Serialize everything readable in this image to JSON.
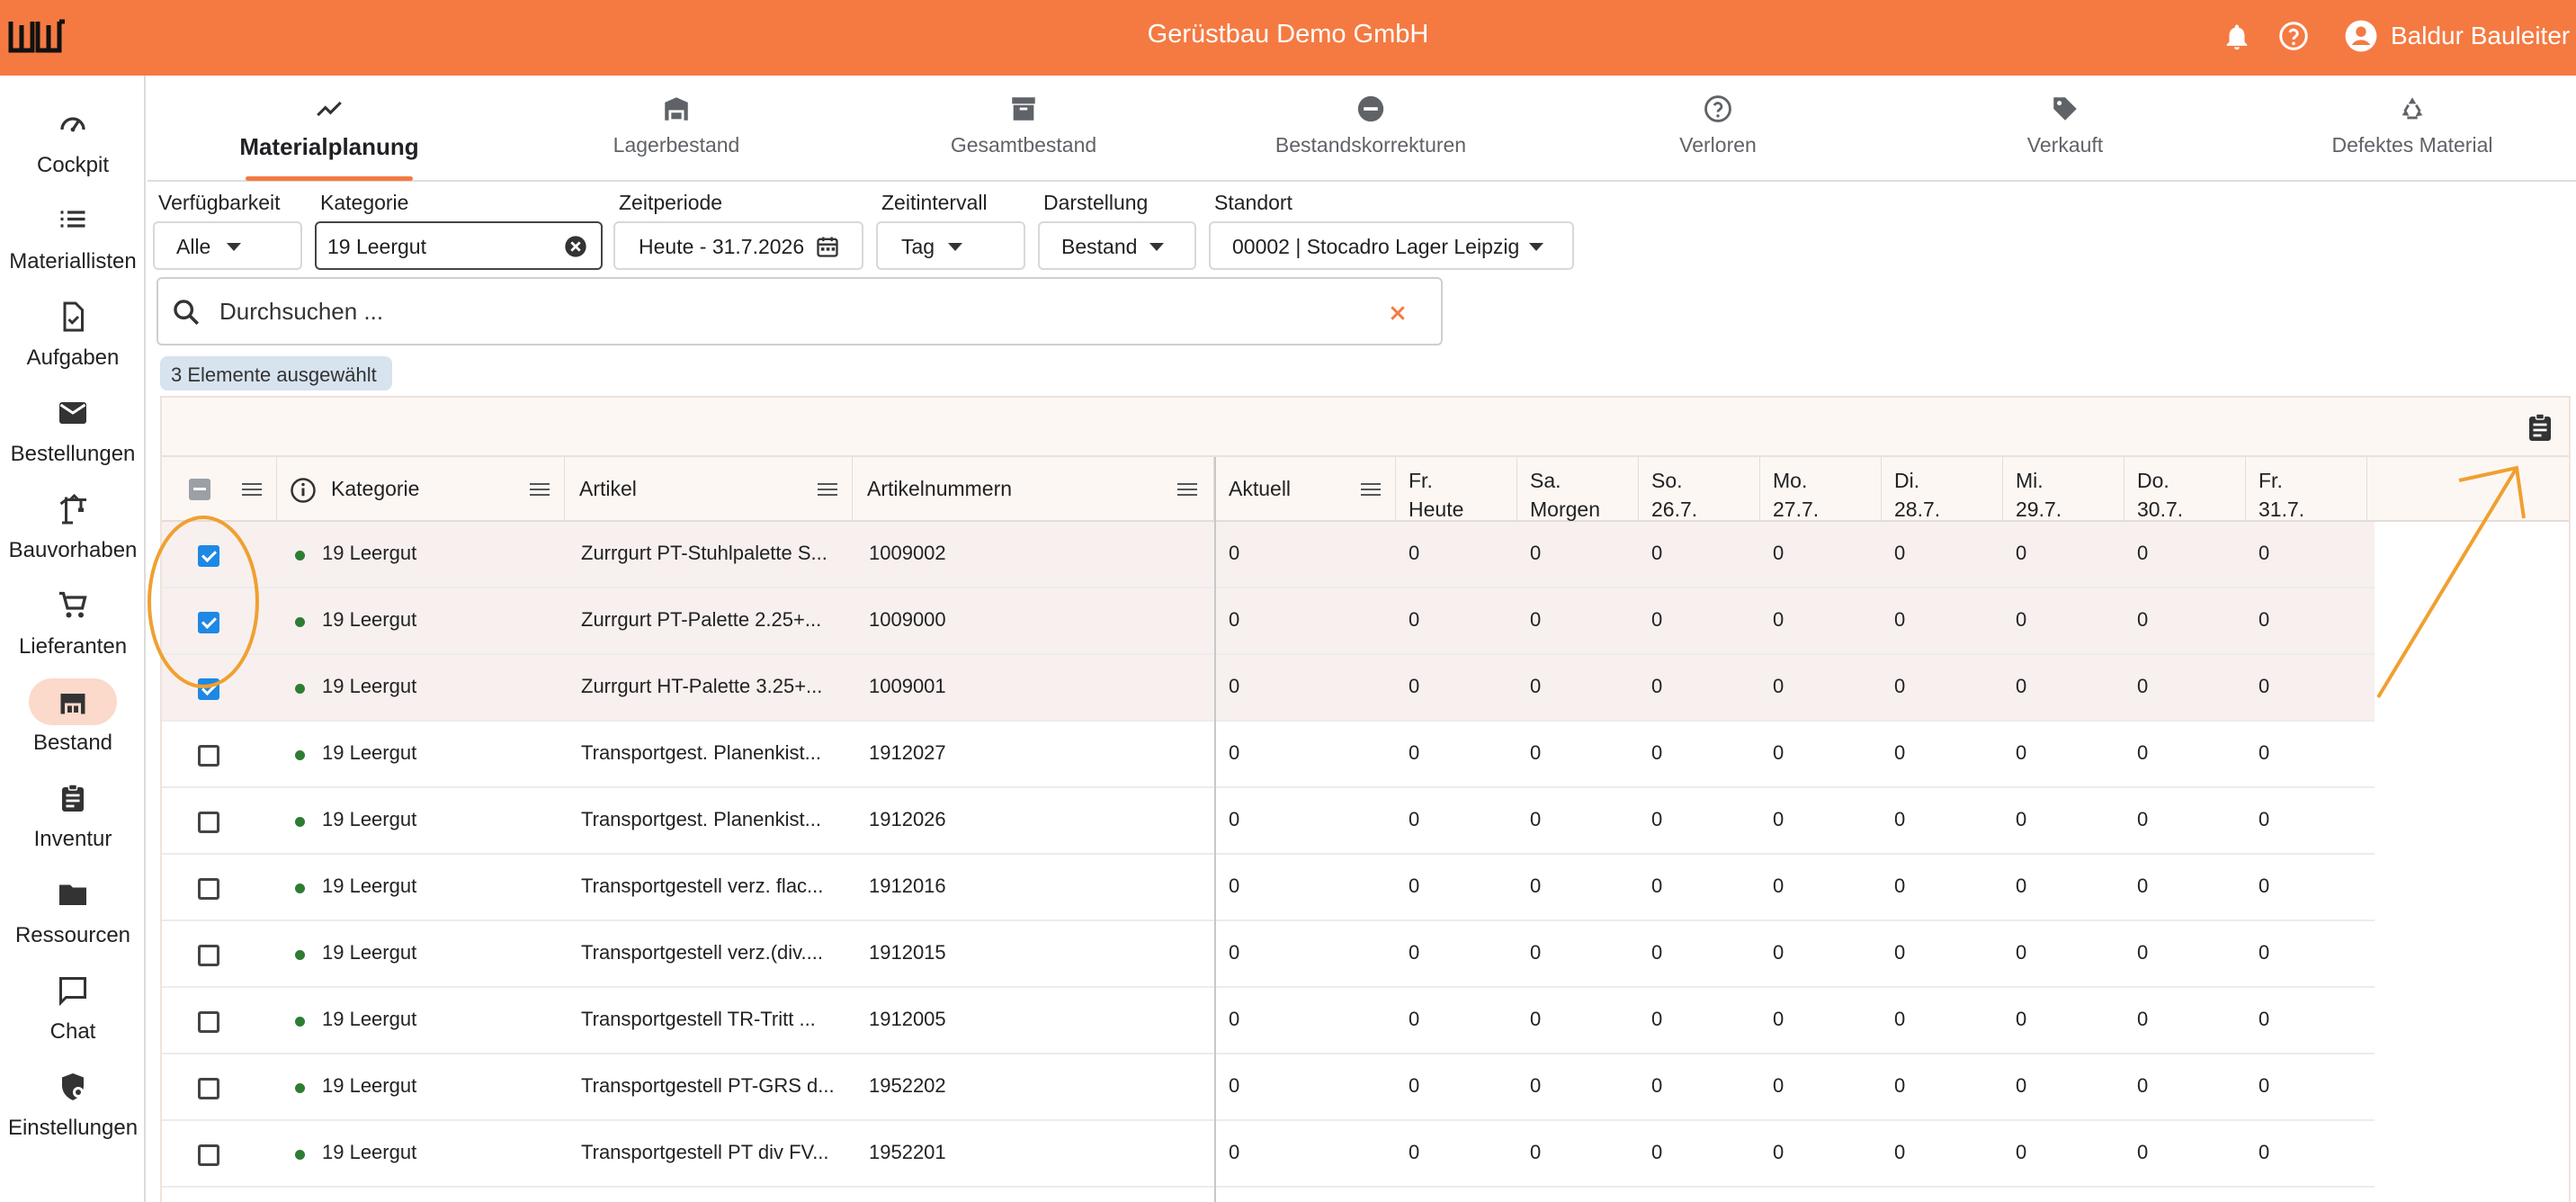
{
  "header": {
    "company": "Gerüstbau Demo GmbH",
    "user_name": "Baldur Bauleiter"
  },
  "sidebar": {
    "items": [
      {
        "label": "Cockpit",
        "icon": "speedometer-icon"
      },
      {
        "label": "Materiallisten",
        "icon": "list-icon"
      },
      {
        "label": "Aufgaben",
        "icon": "task-check-icon"
      },
      {
        "label": "Bestellungen",
        "icon": "mail-icon"
      },
      {
        "label": "Bauvorhaben",
        "icon": "crane-icon"
      },
      {
        "label": "Lieferanten",
        "icon": "cart-icon"
      },
      {
        "label": "Bestand",
        "icon": "warehouse-icon"
      },
      {
        "label": "Inventur",
        "icon": "clipboard-icon"
      },
      {
        "label": "Ressourcen",
        "icon": "folder-icon"
      },
      {
        "label": "Chat",
        "icon": "chat-icon"
      },
      {
        "label": "Einstellungen",
        "icon": "settings-shield-icon"
      }
    ]
  },
  "tabs": [
    {
      "label": "Materialplanung",
      "icon": "trend-icon"
    },
    {
      "label": "Lagerbestand",
      "icon": "warehouse-icon"
    },
    {
      "label": "Gesamtbestand",
      "icon": "archive-icon"
    },
    {
      "label": "Bestandskorrekturen",
      "icon": "minus-circle-icon"
    },
    {
      "label": "Verloren",
      "icon": "question-circle-icon"
    },
    {
      "label": "Verkauft",
      "icon": "tag-icon"
    },
    {
      "label": "Defektes Material",
      "icon": "recycle-icon"
    }
  ],
  "filters": {
    "verfuegbarkeit": {
      "label": "Verfügbarkeit",
      "value": "Alle"
    },
    "kategorie": {
      "label": "Kategorie",
      "value": "19 Leergut"
    },
    "zeitperiode": {
      "label": "Zeitperiode",
      "value": "Heute - 31.7.2026"
    },
    "zeitintervall": {
      "label": "Zeitintervall",
      "value": "Tag"
    },
    "darstellung": {
      "label": "Darstellung",
      "value": "Bestand"
    },
    "standort": {
      "label": "Standort",
      "value": "00002 | Stocadro Lager Leipzig"
    }
  },
  "search": {
    "placeholder": "Durchsuchen ..."
  },
  "selection_chip": "3 Elemente ausgewählt",
  "table": {
    "columns": {
      "kategorie": "Kategorie",
      "artikel": "Artikel",
      "artikelnummern": "Artikelnummern",
      "aktuell": "Aktuell"
    },
    "date_columns": [
      {
        "line1": "Fr.",
        "line2": "Heute"
      },
      {
        "line1": "Sa.",
        "line2": "Morgen"
      },
      {
        "line1": "So.",
        "line2": "26.7."
      },
      {
        "line1": "Mo.",
        "line2": "27.7."
      },
      {
        "line1": "Di.",
        "line2": "28.7."
      },
      {
        "line1": "Mi.",
        "line2": "29.7."
      },
      {
        "line1": "Do.",
        "line2": "30.7."
      },
      {
        "line1": "Fr.",
        "line2": "31.7."
      }
    ],
    "rows": [
      {
        "selected": true,
        "kategorie": "19 Leergut",
        "artikel": "Zurrgurt PT-Stuhlpalette S...",
        "nummer": "1009002",
        "aktuell": "0",
        "values": [
          "0",
          "0",
          "0",
          "0",
          "0",
          "0",
          "0",
          "0"
        ]
      },
      {
        "selected": true,
        "kategorie": "19 Leergut",
        "artikel": "Zurrgurt PT-Palette  2.25+...",
        "nummer": "1009000",
        "aktuell": "0",
        "values": [
          "0",
          "0",
          "0",
          "0",
          "0",
          "0",
          "0",
          "0"
        ]
      },
      {
        "selected": true,
        "kategorie": "19 Leergut",
        "artikel": "Zurrgurt HT-Palette  3.25+...",
        "nummer": "1009001",
        "aktuell": "0",
        "values": [
          "0",
          "0",
          "0",
          "0",
          "0",
          "0",
          "0",
          "0"
        ]
      },
      {
        "selected": false,
        "kategorie": "19 Leergut",
        "artikel": "Transportgest. Planenkist...",
        "nummer": "1912027",
        "aktuell": "0",
        "values": [
          "0",
          "0",
          "0",
          "0",
          "0",
          "0",
          "0",
          "0"
        ]
      },
      {
        "selected": false,
        "kategorie": "19 Leergut",
        "artikel": "Transportgest. Planenkist...",
        "nummer": "1912026",
        "aktuell": "0",
        "values": [
          "0",
          "0",
          "0",
          "0",
          "0",
          "0",
          "0",
          "0"
        ]
      },
      {
        "selected": false,
        "kategorie": "19 Leergut",
        "artikel": "Transportgestell verz. flac...",
        "nummer": "1912016",
        "aktuell": "0",
        "values": [
          "0",
          "0",
          "0",
          "0",
          "0",
          "0",
          "0",
          "0"
        ]
      },
      {
        "selected": false,
        "kategorie": "19 Leergut",
        "artikel": "Transportgestell verz.(div....",
        "nummer": "1912015",
        "aktuell": "0",
        "values": [
          "0",
          "0",
          "0",
          "0",
          "0",
          "0",
          "0",
          "0"
        ]
      },
      {
        "selected": false,
        "kategorie": "19 Leergut",
        "artikel": "Transportgestell TR-Tritt  ...",
        "nummer": "1912005",
        "aktuell": "0",
        "values": [
          "0",
          "0",
          "0",
          "0",
          "0",
          "0",
          "0",
          "0"
        ]
      },
      {
        "selected": false,
        "kategorie": "19 Leergut",
        "artikel": "Transportgestell PT-GRS d...",
        "nummer": "1952202",
        "aktuell": "0",
        "values": [
          "0",
          "0",
          "0",
          "0",
          "0",
          "0",
          "0",
          "0"
        ]
      },
      {
        "selected": false,
        "kategorie": "19 Leergut",
        "artikel": "Transportgestell PT div FV...",
        "nummer": "1952201",
        "aktuell": "0",
        "values": [
          "0",
          "0",
          "0",
          "0",
          "0",
          "0",
          "0",
          "0"
        ]
      }
    ]
  },
  "colors": {
    "brand": "#f47a42",
    "annotation": "#f0a030",
    "checkbox": "#1e88e5",
    "status_dot": "#2e7d32"
  }
}
